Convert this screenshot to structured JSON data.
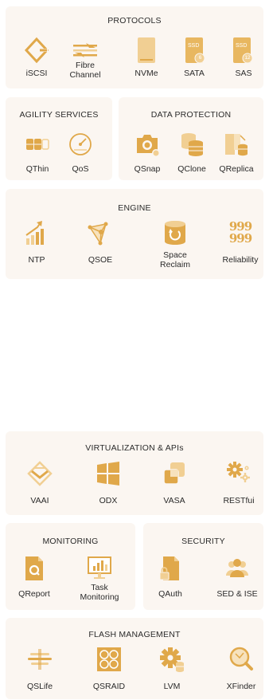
{
  "protocols": {
    "title": "PROTOCOLS",
    "items": [
      {
        "label": "iSCSI",
        "icon": "iscsi-icon"
      },
      {
        "label": "Fibre Channel",
        "icon": "fibre-channel-icon"
      },
      {
        "label": "NVMe",
        "icon": "nvme-icon"
      },
      {
        "label": "SATA",
        "icon": "sata-ssd-icon",
        "badge": "6"
      },
      {
        "label": "SAS",
        "icon": "sas-ssd-icon",
        "badge": "12"
      }
    ],
    "ssd_text": "SSD"
  },
  "agility": {
    "title": "AGILITY SERVICES",
    "items": [
      {
        "label": "QThin",
        "icon": "qthin-icon"
      },
      {
        "label": "QoS",
        "icon": "qos-icon"
      }
    ]
  },
  "data_protection": {
    "title": "DATA PROTECTION",
    "items": [
      {
        "label": "QSnap",
        "icon": "qsnap-icon"
      },
      {
        "label": "QClone",
        "icon": "qclone-icon"
      },
      {
        "label": "QReplica",
        "icon": "qreplica-icon"
      }
    ]
  },
  "engine": {
    "title": "ENGINE",
    "items": [
      {
        "label": "NTP",
        "icon": "ntp-icon"
      },
      {
        "label": "QSOE",
        "icon": "qsoe-icon"
      },
      {
        "label": "Space Reclaim",
        "icon": "space-reclaim-icon"
      },
      {
        "label": "Reliability",
        "icon": "reliability-icon",
        "glyphs": "999"
      }
    ]
  },
  "virtualization": {
    "title": "VIRTUALIZATION & APIs",
    "items": [
      {
        "label": "VAAI",
        "icon": "vaai-icon"
      },
      {
        "label": "ODX",
        "icon": "odx-icon"
      },
      {
        "label": "VASA",
        "icon": "vasa-icon"
      },
      {
        "label": "RESTfui",
        "icon": "restful-icon"
      }
    ]
  },
  "monitoring": {
    "title": "MONITORING",
    "items": [
      {
        "label": "QReport",
        "icon": "qreport-icon"
      },
      {
        "label": "Task Monitoring",
        "icon": "task-monitoring-icon"
      }
    ]
  },
  "security": {
    "title": "SECURITY",
    "items": [
      {
        "label": "QAuth",
        "icon": "qauth-icon"
      },
      {
        "label": "SED & ISE",
        "icon": "sed-ise-icon"
      }
    ]
  },
  "flash": {
    "title": "FLASH MANAGEMENT",
    "items": [
      {
        "label": "QSLife",
        "icon": "qslife-icon"
      },
      {
        "label": "QSRAID",
        "icon": "qsraid-icon"
      },
      {
        "label": "LVM",
        "icon": "lvm-icon"
      },
      {
        "label": "XFinder",
        "icon": "xfinder-icon"
      }
    ]
  },
  "colors": {
    "panel_bg": "#fbf6f1",
    "accent": "#e0a84a",
    "accent_light": "#f1cf93",
    "accent_pale": "#f7e2bd",
    "text": "#2b2b2b"
  }
}
